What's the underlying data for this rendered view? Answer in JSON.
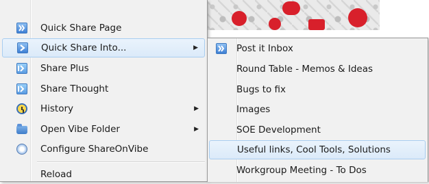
{
  "main_menu": {
    "items": [
      {
        "label": "Quick Share Page",
        "icon": "share-arrows-icon",
        "has_submenu": false
      },
      {
        "label": "Quick Share Into...",
        "icon": "share-arrow-icon",
        "has_submenu": true
      },
      {
        "label": "Share Plus",
        "icon": "share-plus-icon",
        "has_submenu": false
      },
      {
        "label": "Share Thought",
        "icon": "share-plus-icon",
        "has_submenu": false
      },
      {
        "label": "History",
        "icon": "clock-icon",
        "has_submenu": true
      },
      {
        "label": "Open Vibe Folder",
        "icon": "folder-icon",
        "has_submenu": true
      },
      {
        "label": "Configure ShareOnVibe",
        "icon": "config-icon",
        "has_submenu": false
      },
      {
        "label": "Reload",
        "icon": "",
        "has_submenu": false
      }
    ],
    "chevron": "▶"
  },
  "submenu": {
    "items": [
      {
        "label": "Post it Inbox",
        "icon": "share-arrows-icon"
      },
      {
        "label": "Round Table - Memos & Ideas"
      },
      {
        "label": "Bugs to fix"
      },
      {
        "label": "Images"
      },
      {
        "label": "SOE Development"
      },
      {
        "label": "Useful links, Cool Tools, Solutions"
      },
      {
        "label": "Workgroup Meeting - To Dos"
      }
    ]
  },
  "colors": {
    "menu_bg": "#f1f1f1",
    "highlight_bg": "#dbeaf9",
    "highlight_border": "#a8cdf0",
    "icon_blue": "#3d7fd4",
    "accent_red": "#d8202b"
  }
}
